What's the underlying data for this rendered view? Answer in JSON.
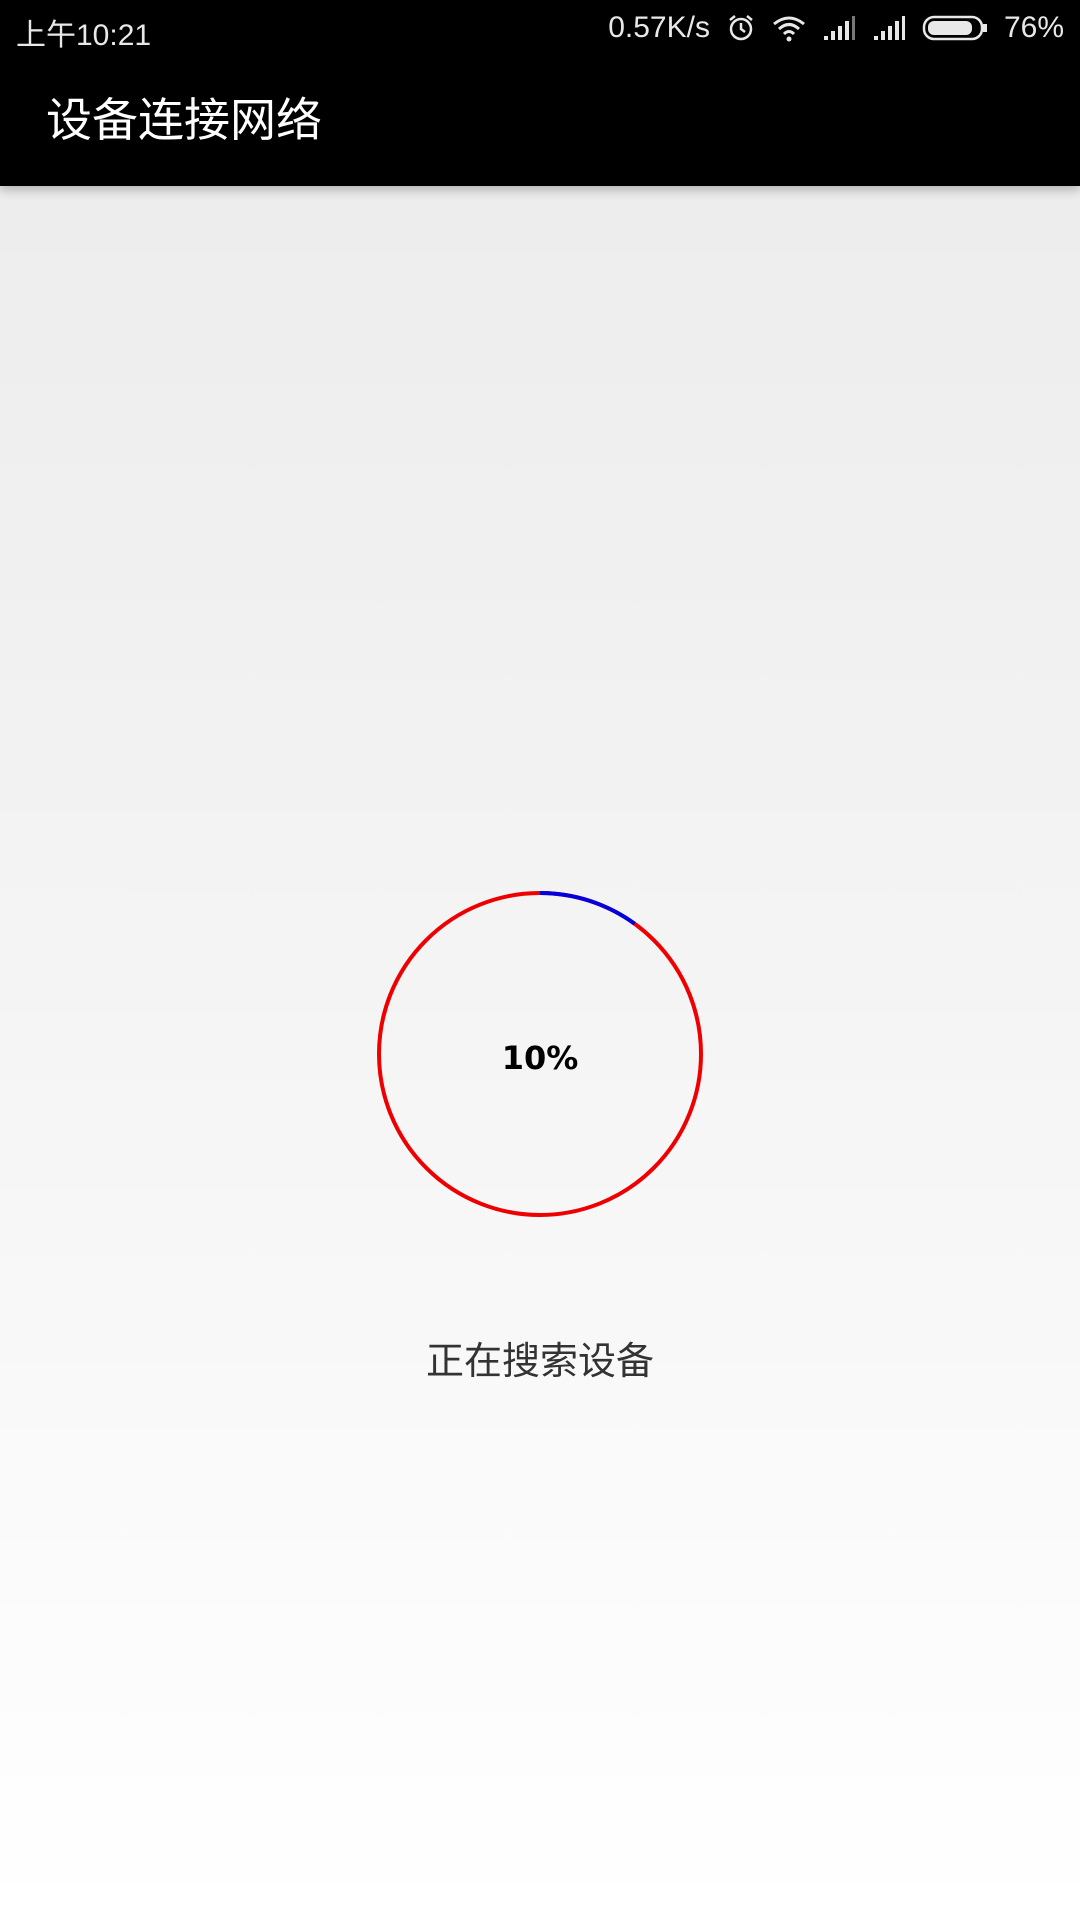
{
  "status_bar": {
    "time": "上午10:21",
    "network_speed": "0.57K/s",
    "battery_percent": "76%",
    "icons": [
      "alarm-icon",
      "wifi-icon",
      "signal-icon",
      "signal-icon",
      "battery-icon"
    ]
  },
  "toolbar": {
    "title": "设备连接网络"
  },
  "progress": {
    "label": "10%",
    "value": 0.1,
    "track_color": "#ee0000",
    "fill_color": "#0000dd"
  },
  "message": "正在搜索设备",
  "colors": {
    "toolbar_bg": "#000000",
    "title_text": "#ffffff"
  }
}
